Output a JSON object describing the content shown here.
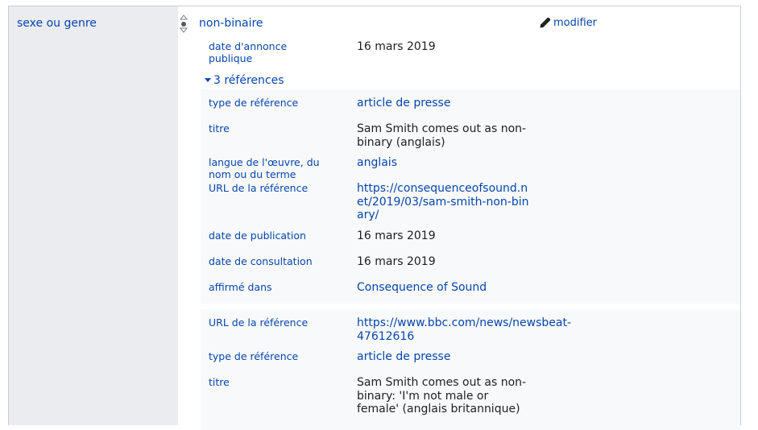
{
  "property": {
    "label": "sexe ou genre"
  },
  "statement": {
    "value": "non-binaire",
    "edit_label": "modifier"
  },
  "qualifier": {
    "label": "date d'annonce publique",
    "value": "16 mars 2019"
  },
  "references": {
    "toggle_label": "3 références",
    "ref1": [
      {
        "label": "type de référence",
        "value": "article de presse",
        "kind": "link"
      },
      {
        "label": "titre",
        "value": "Sam Smith comes out as non-binary (anglais)",
        "kind": "text"
      },
      {
        "label": "langue de l'œuvre, du nom ou du terme",
        "value": "anglais",
        "kind": "link"
      },
      {
        "label": "URL de la référence",
        "value": "https://consequenceofsound.net/2019/03/sam-smith-non-binary/",
        "kind": "link"
      },
      {
        "label": "date de publication",
        "value": "16 mars 2019",
        "kind": "text"
      },
      {
        "label": "date de consultation",
        "value": "16 mars 2019",
        "kind": "text"
      },
      {
        "label": "affirmé dans",
        "value": "Consequence of Sound",
        "kind": "link"
      }
    ],
    "ref2": [
      {
        "label": "URL de la référence",
        "value": "https://www.bbc.com/news/newsbeat-47612616",
        "kind": "link"
      },
      {
        "label": "type de référence",
        "value": "article de presse",
        "kind": "link"
      },
      {
        "label": "titre",
        "value": "Sam Smith comes out as non-binary: 'I'm not male or female' (anglais britannique)",
        "kind": "text"
      }
    ]
  },
  "icons": {
    "rank": "rank-selector-icon",
    "edit": "pencil-icon",
    "toggle": "triangle-down-icon"
  }
}
